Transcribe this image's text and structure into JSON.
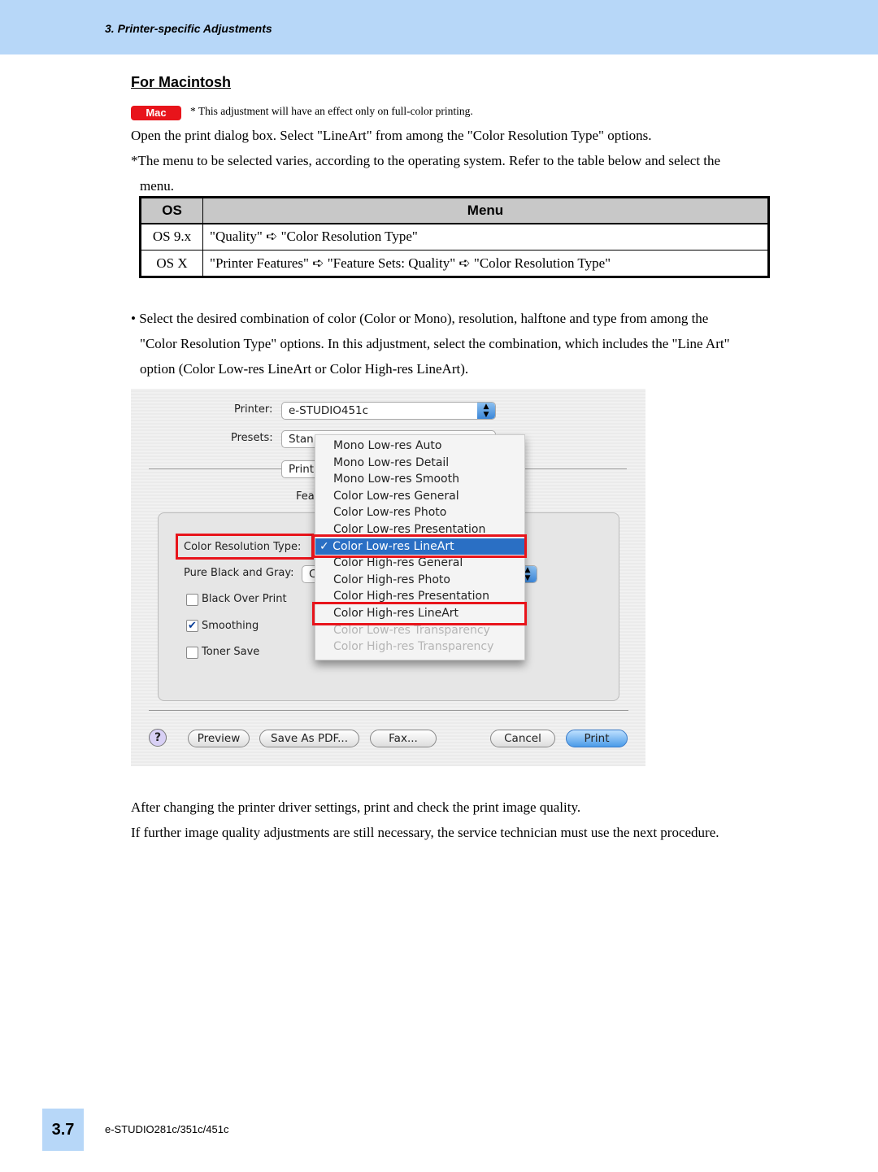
{
  "header": {
    "section": "3. Printer-specific Adjustments"
  },
  "heading": "For Macintosh",
  "badge": "Mac",
  "note": "* This adjustment will have an effect only on full-color printing.",
  "intro": [
    "Open the print dialog box.  Select \"LineArt\" from among the \"Color Resolution Type\" options.",
    "*The menu to be selected varies, according to the operating system. Refer to the table below and select the",
    "menu."
  ],
  "table": {
    "headers": [
      "OS",
      "Menu"
    ],
    "rows": [
      [
        "OS 9.x",
        "\"Quality\" ➪ \"Color Resolution Type\""
      ],
      [
        "OS X",
        "\"Printer Features\" ➪ \"Feature Sets: Quality\" ➪ \"Color Resolution Type\""
      ]
    ]
  },
  "bullet": [
    "• Select the desired combination of color (Color or Mono), resolution, halftone and type from among the",
    "\"Color Resolution Type\" options.  In this adjustment, select the combination, which includes the \"Line Art\"",
    "option (Color Low-res LineArt or Color High-res LineArt)."
  ],
  "dialog": {
    "printer_label": "Printer:",
    "printer_value": "e-STUDIO451c",
    "presets_label": "Presets:",
    "presets_value": "Stan",
    "panel_value": "Print",
    "feature_label": "Fea",
    "crt_label": "Color Resolution Type:",
    "pbg_label": "Pure Black and Gray:",
    "pbg_value": "C",
    "checkboxes": [
      {
        "label": "Black Over Print",
        "checked": false
      },
      {
        "label": "Smoothing",
        "checked": true
      },
      {
        "label": "Toner Save",
        "checked": false
      }
    ],
    "menu": [
      {
        "label": "Mono Low-res Auto",
        "state": "normal"
      },
      {
        "label": "Mono Low-res Detail",
        "state": "normal"
      },
      {
        "label": "Mono Low-res Smooth",
        "state": "normal"
      },
      {
        "label": "Color Low-res General",
        "state": "normal"
      },
      {
        "label": "Color Low-res Photo",
        "state": "normal"
      },
      {
        "label": "Color Low-res Presentation",
        "state": "normal"
      },
      {
        "label": "✓ Color Low-res LineArt",
        "state": "selected"
      },
      {
        "label": "Color High-res General",
        "state": "normal"
      },
      {
        "label": "Color High-res Photo",
        "state": "normal"
      },
      {
        "label": "Color High-res Presentation",
        "state": "normal"
      },
      {
        "label": "Color High-res LineArt",
        "state": "normal"
      },
      {
        "label": "Color Low-res Transparency",
        "state": "disabled"
      },
      {
        "label": "Color High-res Transparency",
        "state": "disabled"
      }
    ],
    "buttons": {
      "help": "?",
      "preview": "Preview",
      "pdf": "Save As PDF...",
      "fax": "Fax...",
      "cancel": "Cancel",
      "print": "Print"
    },
    "highlight_color": "#e8141b"
  },
  "after": [
    "After changing the printer driver settings, print and check the print image quality.",
    "If further image quality adjustments are still necessary, the service technician must use the next procedure."
  ],
  "footer": {
    "page": "3.7",
    "model": "e-STUDIO281c/351c/451c"
  }
}
